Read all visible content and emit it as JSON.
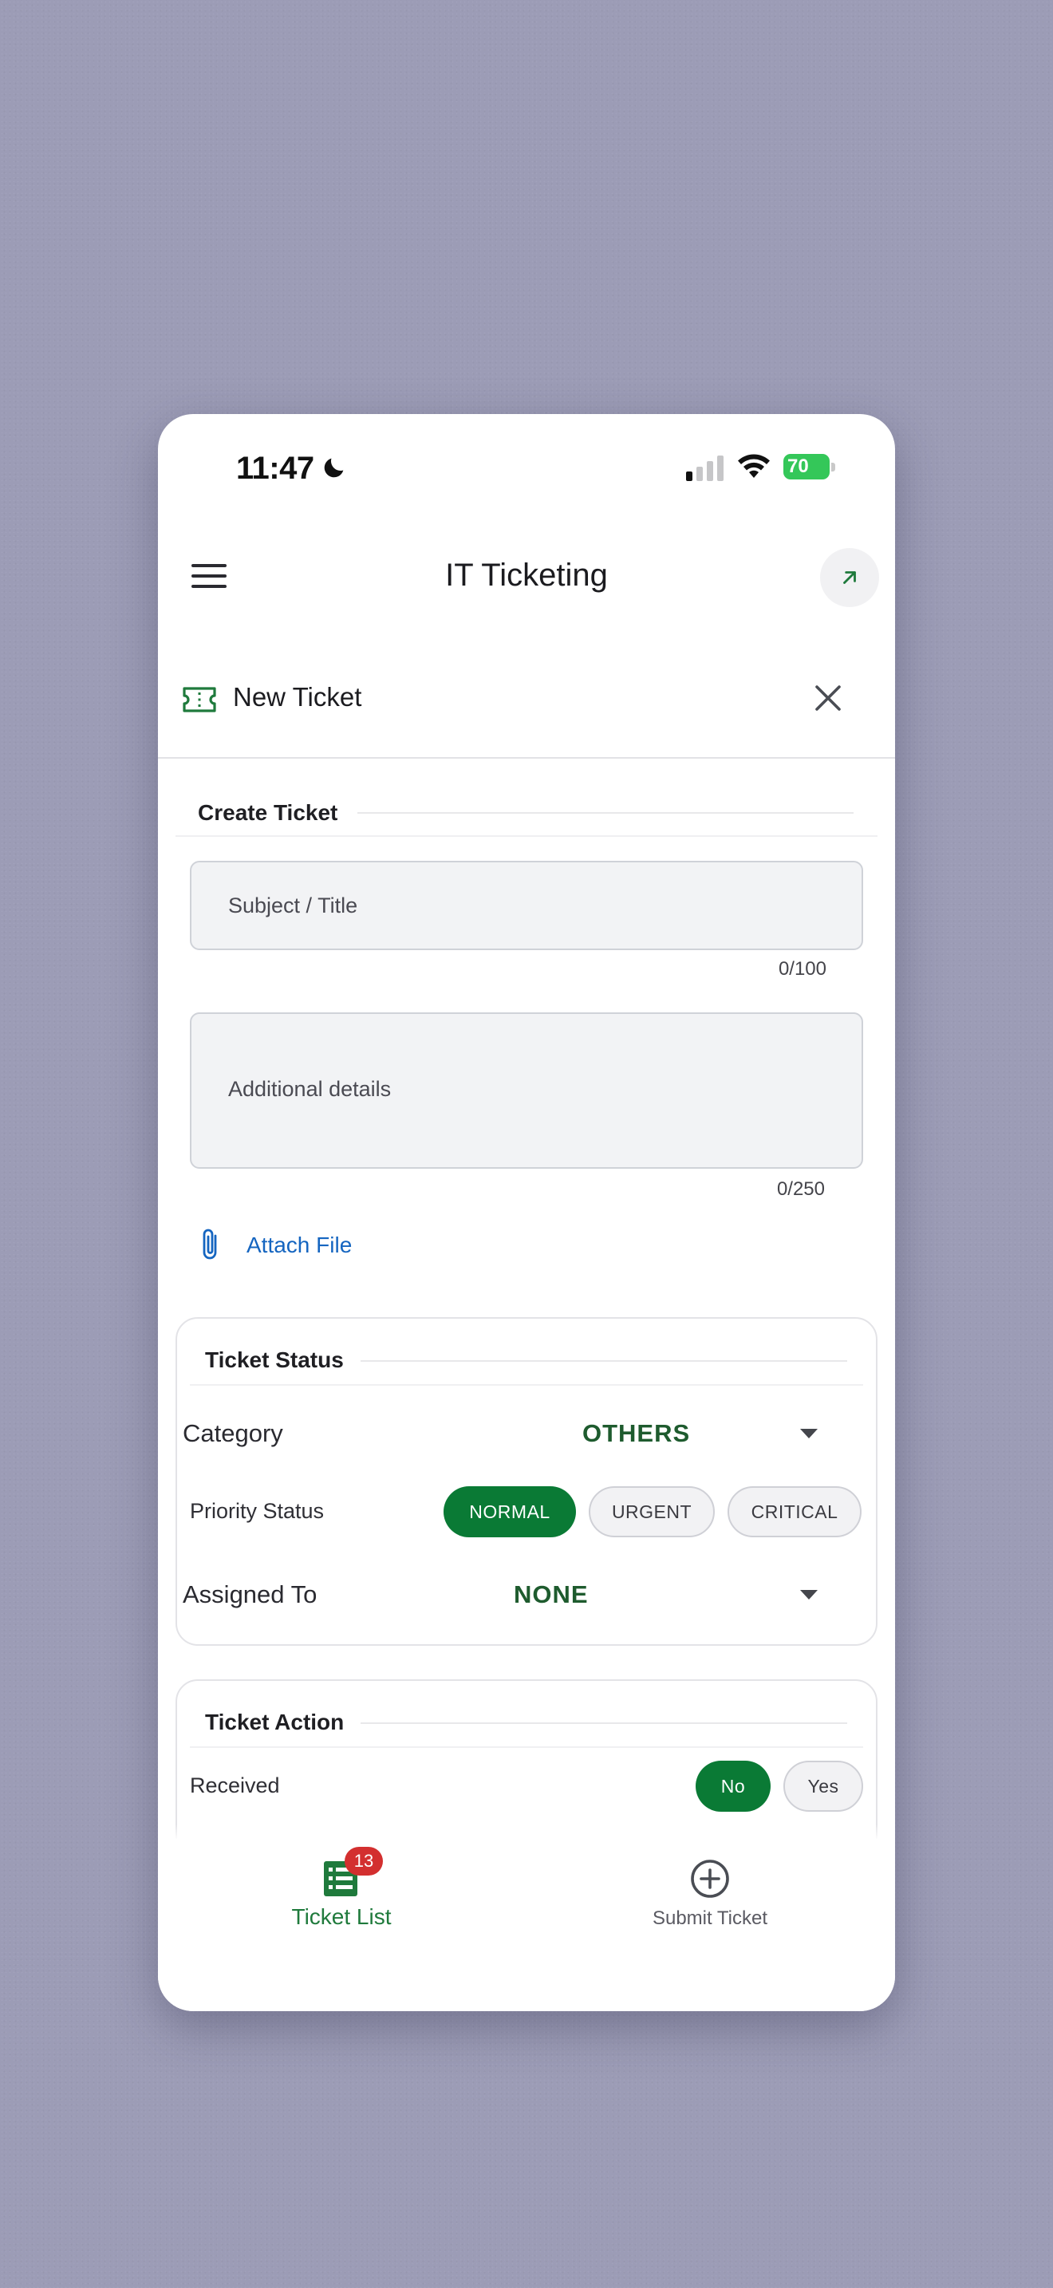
{
  "status_bar": {
    "time": "11:47",
    "battery": "70"
  },
  "app_bar": {
    "title": "IT Ticketing"
  },
  "form_header": {
    "title": "New Ticket"
  },
  "create_ticket": {
    "section_title": "Create Ticket",
    "subject_placeholder": "Subject / Title",
    "subject_counter": "0/100",
    "details_placeholder": "Additional details",
    "details_counter": "0/250",
    "attach_label": "Attach File"
  },
  "ticket_status": {
    "section_title": "Ticket Status",
    "category_label": "Category",
    "category_value": "OTHERS",
    "priority_label": "Priority Status",
    "priority_options": [
      "NORMAL",
      "URGENT",
      "CRITICAL"
    ],
    "priority_selected": "NORMAL",
    "assigned_label": "Assigned To",
    "assigned_value": "NONE"
  },
  "ticket_action": {
    "section_title": "Ticket Action",
    "received_label": "Received",
    "received_options": [
      "No",
      "Yes"
    ],
    "received_selected": "No"
  },
  "bottom_nav": {
    "items": [
      {
        "label": "Ticket List",
        "badge": "13",
        "active": true
      },
      {
        "label": "Submit Ticket",
        "active": false
      }
    ]
  },
  "colors": {
    "primary_green": "#0a7a35",
    "link_blue": "#1565c0",
    "badge_red": "#d32f2f",
    "background": "#9c9cb6"
  }
}
